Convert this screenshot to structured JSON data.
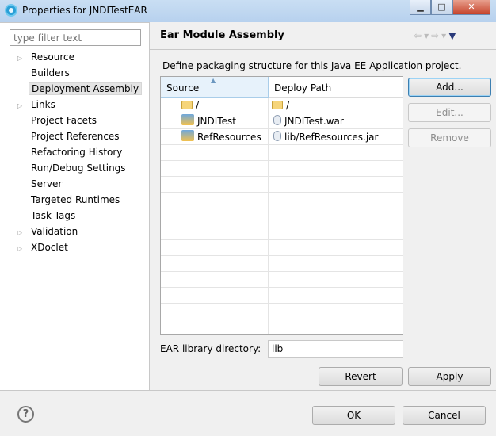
{
  "window": {
    "title": "Properties for JNDITestEAR",
    "minimize": "▁",
    "maximize": "□",
    "close": "✕"
  },
  "sidebar": {
    "filter_placeholder": "type filter text",
    "items": [
      {
        "label": "Resource",
        "expandable": true
      },
      {
        "label": "Builders",
        "expandable": false
      },
      {
        "label": "Deployment Assembly",
        "expandable": false,
        "selected": true
      },
      {
        "label": "Links",
        "expandable": true
      },
      {
        "label": "Project Facets",
        "expandable": false
      },
      {
        "label": "Project References",
        "expandable": false
      },
      {
        "label": "Refactoring History",
        "expandable": false
      },
      {
        "label": "Run/Debug Settings",
        "expandable": false
      },
      {
        "label": "Server",
        "expandable": false
      },
      {
        "label": "Targeted Runtimes",
        "expandable": false
      },
      {
        "label": "Task Tags",
        "expandable": false
      },
      {
        "label": "Validation",
        "expandable": true
      },
      {
        "label": "XDoclet",
        "expandable": true
      }
    ]
  },
  "page": {
    "title": "Ear Module Assembly",
    "nav": {
      "back": "⇦",
      "back_menu": "▾",
      "forward": "⇨",
      "forward_menu": "▾",
      "view_menu": "▼"
    },
    "description": "Define packaging structure for this Java EE Application project.",
    "table": {
      "columns": [
        "Source",
        "Deploy Path"
      ],
      "sort_indicator": "▲",
      "rows": [
        {
          "source": "/",
          "source_icon": "folder-icon",
          "path": "/",
          "path_icon": "folder-icon"
        },
        {
          "source": "JNDITest",
          "source_icon": "web-project-icon",
          "path": "JNDITest.war",
          "path_icon": "jar-icon"
        },
        {
          "source": "RefResources",
          "source_icon": "project-icon",
          "path": "lib/RefResources.jar",
          "path_icon": "jar-icon"
        }
      ]
    },
    "buttons": {
      "add": "Add...",
      "edit": "Edit...",
      "remove": "Remove"
    },
    "ear_library_label": "EAR library directory:",
    "ear_library_value": "lib",
    "revert": "Revert",
    "apply": "Apply"
  },
  "footer": {
    "help": "?",
    "ok": "OK",
    "cancel": "Cancel"
  }
}
